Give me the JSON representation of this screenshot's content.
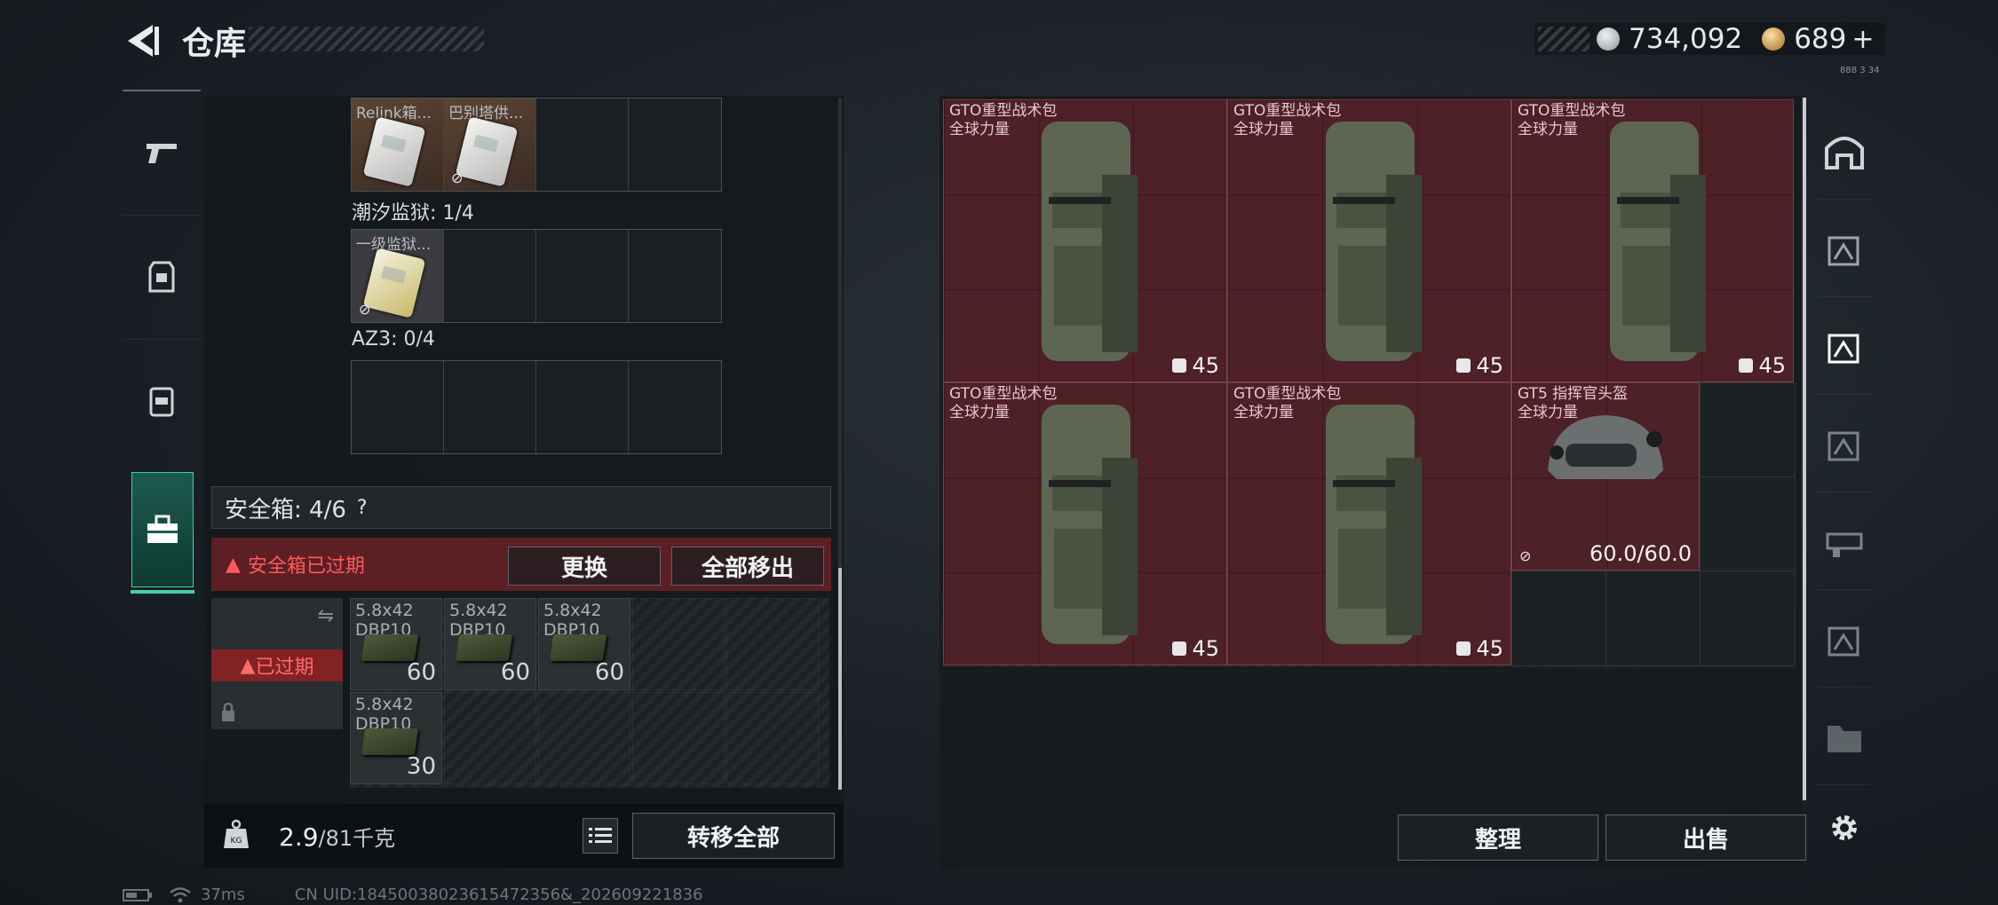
{
  "header": {
    "title": "仓库",
    "currency_silver": "734,092",
    "currency_gold": "689",
    "plus": "+",
    "tiny_code": "888 3 34"
  },
  "left_panel": {
    "row1": [
      {
        "label": "Relink箱...",
        "filled": true,
        "style": "orange"
      },
      {
        "label": "巴别塔供...",
        "filled": true,
        "style": "orange",
        "no_trade": true
      },
      {
        "label": "",
        "filled": false
      },
      {
        "label": "",
        "filled": false
      }
    ],
    "section2_label": "潮汐监狱: 1/4",
    "row2": [
      {
        "label": "一级监狱...",
        "filled": true,
        "style": "gray",
        "no_trade": true
      },
      {
        "label": "",
        "filled": false
      },
      {
        "label": "",
        "filled": false
      },
      {
        "label": "",
        "filled": false
      }
    ],
    "section3_label": "AZ3: 0/4",
    "safe": {
      "label": "安全箱:  4/6",
      "help": "?",
      "expired_warning": "安全箱已过期",
      "replace_button": "更换",
      "move_all_button": "全部移出",
      "expired_badge": "已过期",
      "items": [
        {
          "name": "5.8x42\nDBP10",
          "count": "60"
        },
        {
          "name": "5.8x42\nDBP10",
          "count": "60"
        },
        {
          "name": "5.8x42\nDBP10",
          "count": "60"
        },
        {
          "name": "5.8x42\nDBP10",
          "count": "30"
        }
      ]
    },
    "footer": {
      "weight_current": "2.9",
      "weight_max": "/81千克",
      "transfer_all_button": "转移全部",
      "weight_icon_text": "KG"
    }
  },
  "right_panel": {
    "items": [
      {
        "name": "GTO重型战术包\n全球力量",
        "count": "45",
        "type": "backpack"
      },
      {
        "name": "GTO重型战术包\n全球力量",
        "count": "45",
        "type": "backpack"
      },
      {
        "name": "GTO重型战术包\n全球力量",
        "count": "45",
        "type": "backpack"
      },
      {
        "name": "GTO重型战术包\n全球力量",
        "count": "45",
        "type": "backpack"
      },
      {
        "name": "GTO重型战术包\n全球力量",
        "count": "45",
        "type": "backpack"
      },
      {
        "name": "GT5 指挥官头盔\n全球力量",
        "count": "60.0/60.0",
        "type": "helmet"
      }
    ],
    "organize_button": "整理",
    "sell_button": "出售"
  },
  "status_bar": {
    "ping": "37ms",
    "uid": "CN UID:18450038023615472356&_202609221836"
  },
  "colors": {
    "accent_teal": "#3fd1a8",
    "item_red": "#4e2027",
    "warning_red": "#ff5a5a"
  }
}
